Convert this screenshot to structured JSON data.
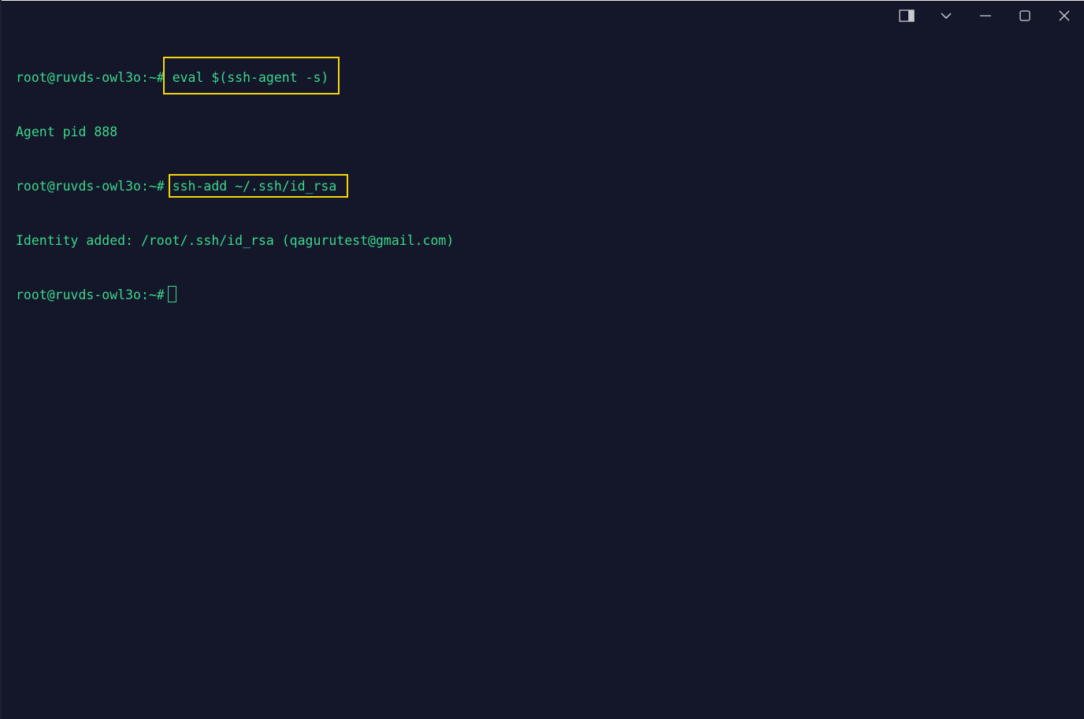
{
  "terminal": {
    "lines": [
      {
        "prompt": "root@ruvds-owl3o:~#",
        "command": "eval $(ssh-agent -s)"
      },
      {
        "output": "Agent pid 888"
      },
      {
        "prompt": "root@ruvds-owl3o:~#",
        "command": "ssh-add ~/.ssh/id_rsa"
      },
      {
        "output": "Identity added: /root/.ssh/id_rsa (qagurutest@gmail.com)"
      },
      {
        "prompt": "root@ruvds-owl3o:~#",
        "command": ""
      }
    ]
  },
  "icons": {
    "panel": "split-pane-icon",
    "dropdown": "chevron-down-icon",
    "minimize": "minimize-icon",
    "maximize": "maximize-icon",
    "close": "close-icon"
  },
  "colors": {
    "background": "#14172a",
    "text": "#3dd68c",
    "highlight": "#f5d60a"
  }
}
